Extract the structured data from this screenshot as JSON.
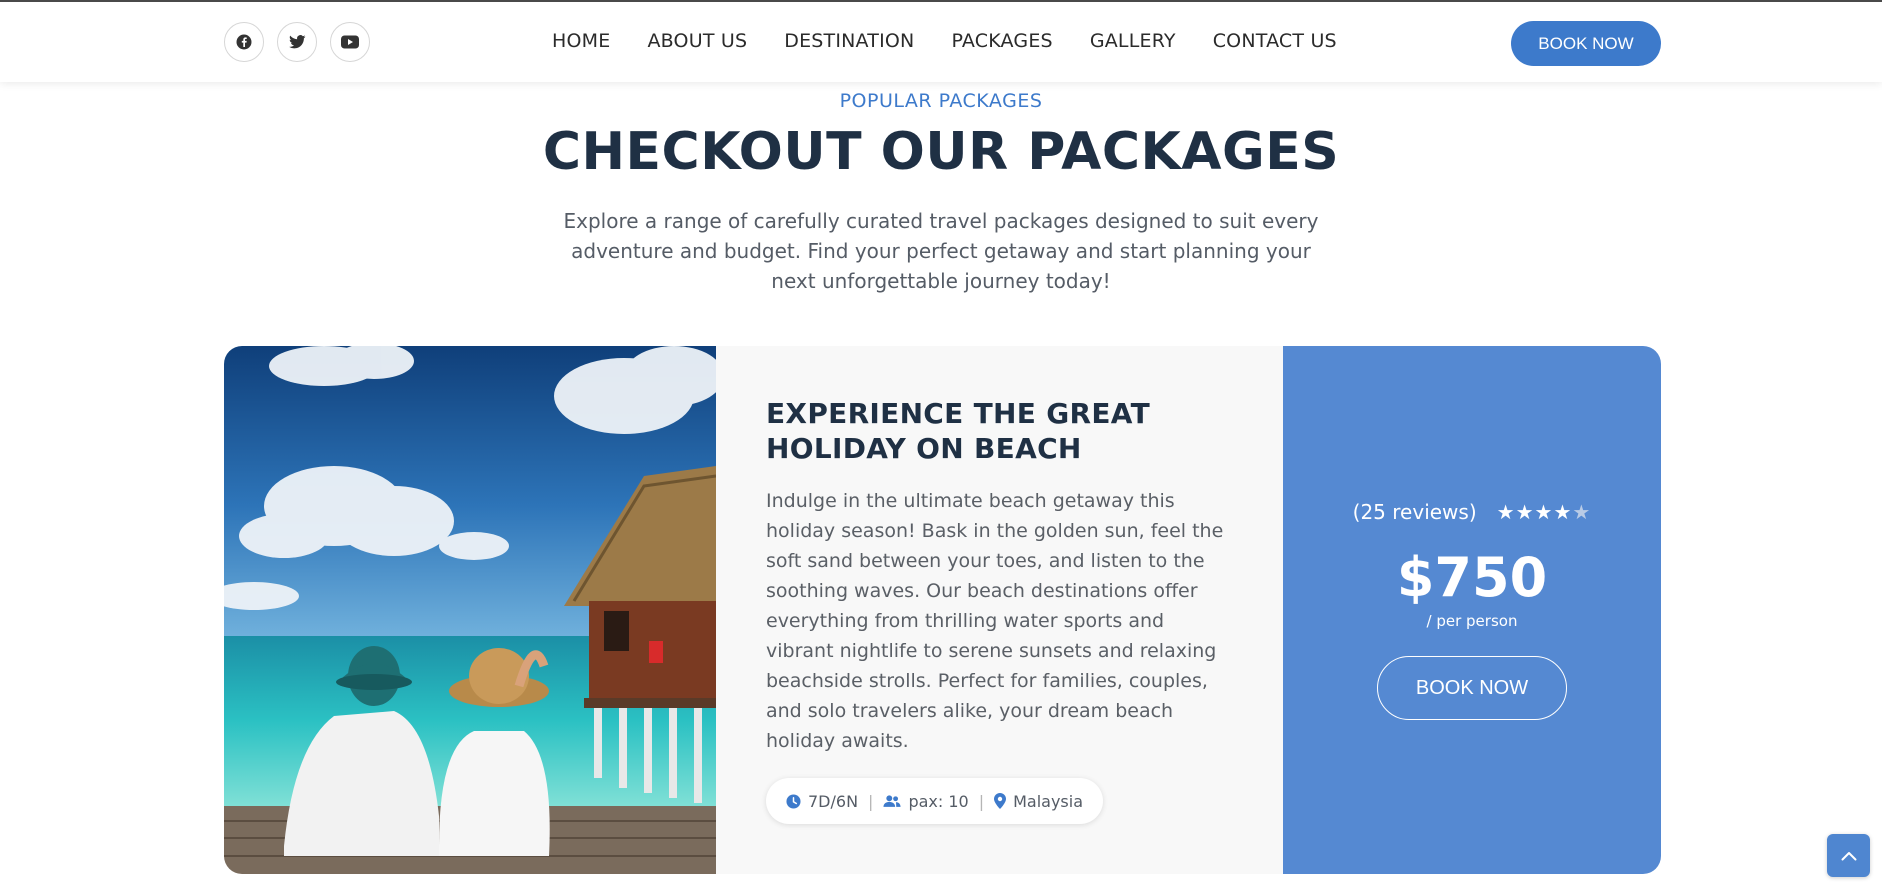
{
  "header": {
    "socials": [
      {
        "icon": "facebook-icon"
      },
      {
        "icon": "twitter-icon"
      },
      {
        "icon": "youtube-icon"
      }
    ],
    "nav": [
      "HOME",
      "ABOUT US",
      "DESTINATION",
      "PACKAGES",
      "GALLERY",
      "CONTACT US"
    ],
    "book_label": "BOOK NOW"
  },
  "section": {
    "eyebrow": "POPULAR PACKAGES",
    "title": "CHECKOUT OUR PACKAGES",
    "intro": "Explore a range of carefully curated travel packages designed to suit every adventure and budget. Find your perfect getaway and start planning your next unforgettable journey today!"
  },
  "package": {
    "title": "EXPERIENCE THE GREAT HOLIDAY ON BEACH",
    "description": "Indulge in the ultimate beach getaway this holiday season! Bask in the golden sun, feel the soft sand between your toes, and listen to the soothing waves. Our beach destinations offer everything from thrilling water sports and vibrant nightlife to serene sunsets and relaxing beachside strolls. Perfect for families, couples, and solo travelers alike, your dream beach holiday awaits.",
    "duration": "7D/6N",
    "pax": "pax: 10",
    "location": "Malaysia",
    "reviews": "(25 reviews)",
    "rating": 4,
    "rating_max": 5,
    "price": "$750",
    "per": "/ per person",
    "book_label": "BOOK NOW"
  },
  "colors": {
    "accent": "#3d7acb",
    "price_panel": "#5589d2",
    "heading": "#1f3044"
  }
}
